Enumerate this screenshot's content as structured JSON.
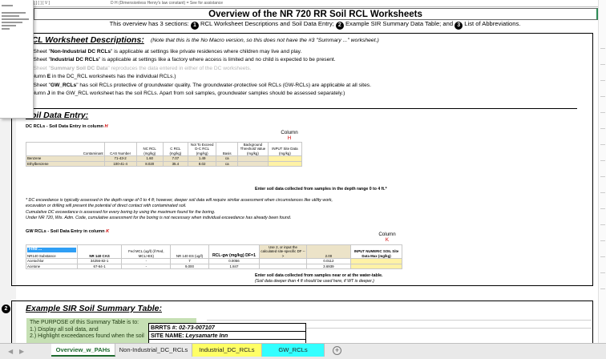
{
  "top_row": {
    "left": "[ ] [  ]  [ V ]",
    "mid": "D  H  (Dimensionless  Henry's  law  constant)  =  See  for  assistance"
  },
  "title": "Overview of the NR 720 RR Soil RCL Worksheets",
  "subtitle": {
    "lead": "This overview has 3 sections:",
    "n1": "1",
    "t1": " RCL Worksheet Descriptions and Soil Data Entry;",
    "n2": "2",
    "t2": " Example SIR Summary Data Table; and",
    "n3": "3",
    "t3": " List of Abbreviations."
  },
  "section1": {
    "number": "1",
    "heading": "RCL Worksheet Descriptions:",
    "note": "(Note that this is the No Macro version, so this does not have the #3 \"Summary ...\" worksheet.)",
    "items": [
      {
        "pre": "1.) Sheet \"",
        "bold": "Non-Industrial DC RCLs",
        "post": "\" is applicable at settings like private residences where children may live and play."
      },
      {
        "pre": "2.) Sheet \"",
        "bold": "Industrial DC RCLs",
        "post": "\" is applicable at settings like a factory where access is limited and no child is expected to be present."
      },
      {
        "pre": "3.) Sheet \"",
        "bold": "Summary Soil DC Data",
        "post": "\" reproduces the data entered in either of the DC worksheets."
      },
      {
        "pre": "     (Column ",
        "bold": "E",
        "post": " in the DC_RCL worksheets has the individual RCLs.)"
      },
      {
        "pre": "4.) Sheet \"",
        "bold": "GW_RCLs",
        "post": "\" has soil RCLs protective of groundwater quality. The groundwater-protective soil RCLs (GW-RCLs) are applicable at all sites."
      },
      {
        "pre": "     (Column ",
        "bold": "J",
        "post": " in the GW_RCL worksheet has the soil RCLs.  Apart from soil samples, groundwater samples should be assessed separately.)"
      }
    ],
    "soil_heading": "Soil Data Entry:",
    "dc": {
      "title": "DC RCLs - Soil Data Entry in column ",
      "col": "H",
      "column_word": "Column",
      "headers": [
        "Contaminant",
        "CAS Number",
        "NC RCL (mg/kg)",
        "C RCL (mg/kg)",
        "Not To Exceed D-C RCL (mg/kg)",
        "Basis",
        "Background Threshold Value (mg/kg)",
        "INPUT Site Data (mg/kg)"
      ],
      "rows": [
        [
          "Benzene",
          "71-43-2",
          "1.60",
          "7.07",
          "1.49",
          "ca",
          ""
        ],
        [
          "Ethylbenzene",
          "100-41-4",
          "8.020",
          "35.4",
          "8.02",
          "ca",
          ""
        ]
      ],
      "enter": "Enter soil data collected from samples in the depth range 0 to 4 ft.*"
    },
    "notes": [
      "* DC exceedance is typically assessed in the depth range of 0 to 4 ft; however, deeper soil data will require similar assessment when circumstances like utility work,",
      "excavation or drilling will present the potential of direct contact with contaminated soil.",
      "  Cumulative DC exceedance is assessed for every boring by using the maximum found for the boring.",
      "  Under NR 720, Wis. Adm. Code, cumulative assessment for the boring is not necessary when individual exceedance has already been found."
    ],
    "gw": {
      "title": "GW RCLs - Soil Data Entry in column ",
      "col": "K",
      "column_word": "Column",
      "find": "Find ...",
      "headers": [
        "NR140 Substance",
        "NR 140 CAS",
        "Fed MCL (ug/l) (if Red, MCL>ES)",
        "NR 140 ES (ug/l)",
        "RCL-gw (mg/kg) DF=1",
        "Use 2, or input the calculated site-specific DF -->",
        "2.00",
        "INPUT NUMERIC SOIL Site Data Max (mg/kg)"
      ],
      "rows": [
        [
          "Acetochlor",
          "34256-82-1",
          "-",
          "7",
          "0.0056",
          "",
          "0.0112",
          ""
        ],
        [
          "Acetone",
          "67-64-1",
          "-",
          "9,000",
          "1.847",
          "",
          "3.6939",
          ""
        ]
      ],
      "enter": "Enter soil data collected from samples near or at the water-table.",
      "enter2": "(Soil data deeper than 4 ft should be used here, if WT is deeper.)"
    }
  },
  "section2": {
    "number": "2",
    "heading": "Example SIR Soil Summary Table:",
    "purpose": [
      "The PURPOSE of this Summary Table is to:",
      "1.) Display all soil data, and",
      "2.) Highlight  exceedances found when the soil"
    ],
    "brrts_label": "BRRTS #:",
    "brrts_value": "02-73-007107",
    "site_label": "SITE NAME:",
    "site_value": "Leysamarte Inn"
  },
  "tabs": [
    {
      "label": "Overview_w_PAHs",
      "style": "active"
    },
    {
      "label": "Non-Industrial_DC_RCLs",
      "style": "plain"
    },
    {
      "label": "Industrial_DC_RCLs",
      "style": "yellow"
    },
    {
      "label": "GW_RCLs",
      "style": "cyan"
    }
  ],
  "tab_nav": {
    "prev": "◀",
    "next": "▶",
    "add": "+"
  },
  "colors": {
    "title_border": "#2e8b57",
    "tan": "#ece3c8",
    "input_yellow": "#fff2a6",
    "purpose_green": "#c6e0b4",
    "tab_yellow": "#ffff66",
    "tab_cyan": "#33ffff",
    "red": "#d00000"
  }
}
